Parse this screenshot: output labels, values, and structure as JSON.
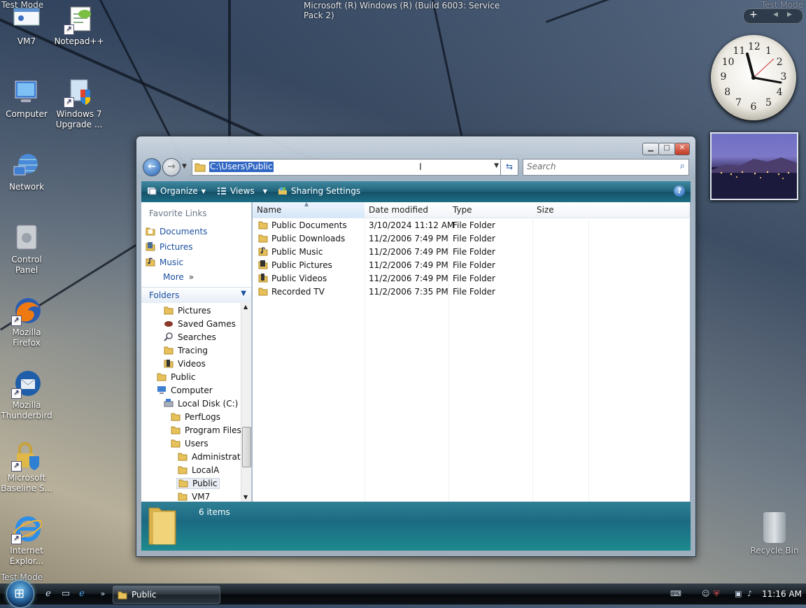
{
  "desktop": {
    "top_title": "Microsoft (R) Windows (R) (Build 6003: Service Pack 2)",
    "test_mode": "Test Mode",
    "icons": [
      {
        "label": "VM7"
      },
      {
        "label": "Notepad++"
      },
      {
        "label": "Computer"
      },
      {
        "label": "Windows 7 Upgrade ..."
      },
      {
        "label": "Network"
      },
      {
        "label": "Control Panel"
      },
      {
        "label": "Mozilla Firefox"
      },
      {
        "label": "Mozilla Thunderbird"
      },
      {
        "label": "Microsoft Baseline S..."
      },
      {
        "label": "Internet Explor..."
      }
    ],
    "recycle_bin": "Recycle Bin"
  },
  "explorer": {
    "address": "C:\\Users\\Public",
    "search_placeholder": "Search",
    "toolbar": {
      "organize": "Organize",
      "views": "Views",
      "sharing": "Sharing Settings"
    },
    "favorites": {
      "header": "Favorite Links",
      "items": [
        "Documents",
        "Pictures",
        "Music"
      ],
      "more": "More"
    },
    "folders_header": "Folders",
    "tree": [
      "Pictures",
      "Saved Games",
      "Searches",
      "Tracing",
      "Videos",
      "Public",
      "Computer",
      "Local Disk (C:)",
      "PerfLogs",
      "Program Files",
      "Users",
      "Administrato",
      "LocalA",
      "Public",
      "VM7"
    ],
    "columns": [
      "Name",
      "Date modified",
      "Type",
      "Size"
    ],
    "files": [
      {
        "name": "Public Documents",
        "date": "3/10/2024 11:12 AM",
        "type": "File Folder",
        "size": ""
      },
      {
        "name": "Public Downloads",
        "date": "11/2/2006 7:49 PM",
        "type": "File Folder",
        "size": ""
      },
      {
        "name": "Public Music",
        "date": "11/2/2006 7:49 PM",
        "type": "File Folder",
        "size": ""
      },
      {
        "name": "Public Pictures",
        "date": "11/2/2006 7:49 PM",
        "type": "File Folder",
        "size": ""
      },
      {
        "name": "Public Videos",
        "date": "11/2/2006 7:49 PM",
        "type": "File Folder",
        "size": ""
      },
      {
        "name": "Recorded TV",
        "date": "11/2/2006 7:35 PM",
        "type": "File Folder",
        "size": ""
      }
    ],
    "details": {
      "count": "6 items"
    }
  },
  "taskbar": {
    "task_label": "Public",
    "time": "11:16 AM"
  },
  "gadgets": {
    "clock_numbers": [
      "12",
      "1",
      "2",
      "3",
      "4",
      "5",
      "6",
      "7",
      "8",
      "9",
      "10",
      "11"
    ]
  },
  "colors": {
    "selection": "#3268c4",
    "toolbar": "#1f6078",
    "link": "#1a4fa0"
  }
}
